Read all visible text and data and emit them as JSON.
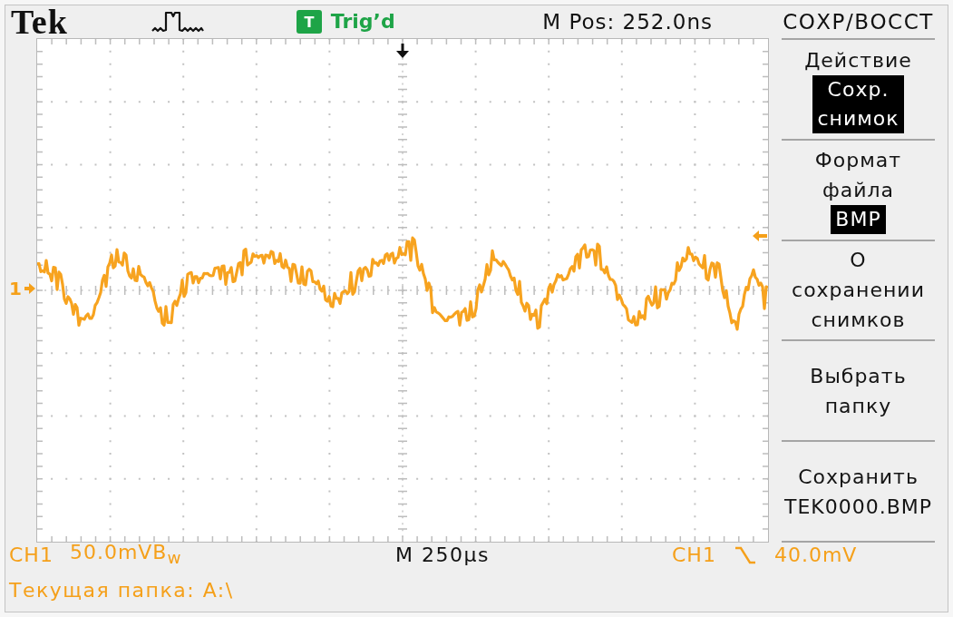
{
  "header": {
    "logo": "Tek",
    "trigger": {
      "indicator": "T",
      "status": "Trig’d"
    },
    "horizontal_position": "M Pos: 252.0ns"
  },
  "display": {
    "channel_marker": "1"
  },
  "menu": {
    "title": "СОХР/ВОССТ",
    "items": [
      {
        "label": "Действие",
        "value": "Сохр.\nснимок"
      },
      {
        "label": "Формат\nфайла",
        "value": "BMP"
      },
      {
        "label": "О\nсохранении\nснимков"
      },
      {
        "label": "Выбрать\nпапку"
      },
      {
        "label": "Сохранить\nTEK0000.BMP"
      }
    ]
  },
  "status_bar": {
    "channel": {
      "name": "CH1",
      "scale": "50.0mVB$_{w}$"
    },
    "timebase": "M 250µs",
    "trigger": {
      "source": "CH1",
      "falling_slope": true,
      "voltage": "40.0mV"
    },
    "current_folder": "Текущая папка: A:\\"
  }
}
